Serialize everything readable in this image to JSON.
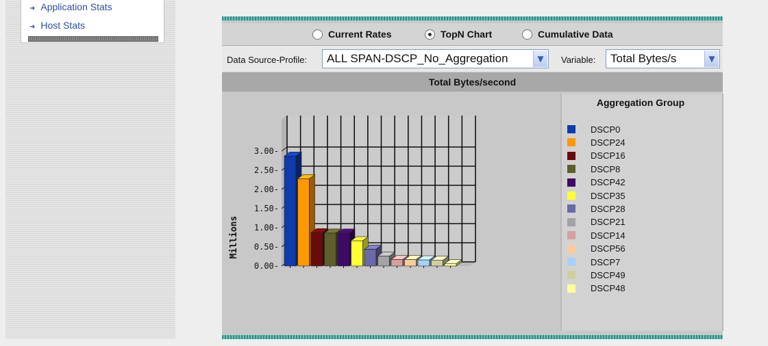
{
  "sidebar": {
    "items": [
      {
        "label": "Application Stats"
      },
      {
        "label": "Host Stats"
      }
    ]
  },
  "controls": {
    "radios": [
      {
        "label": "Current Rates",
        "selected": false
      },
      {
        "label": "TopN Chart",
        "selected": true
      },
      {
        "label": "Cumulative Data",
        "selected": false
      }
    ],
    "data_source_label": "Data Source-Profile:",
    "data_source_value": "ALL SPAN-DSCP_No_Aggregation",
    "variable_label": "Variable:",
    "variable_value": "Total Bytes/s"
  },
  "chart_title": "Total Bytes/second",
  "chart_data": {
    "type": "bar",
    "title": "Total Bytes/second",
    "ylabel": "Millions",
    "ylim": [
      0,
      3.0
    ],
    "yticks": [
      "0.00",
      "0.50",
      "1.00",
      "1.50",
      "2.00",
      "2.50",
      "3.00"
    ],
    "legend_title": "Aggregation Group",
    "legend_position": "right",
    "grid": true,
    "categories": [
      "DSCP0",
      "DSCP24",
      "DSCP16",
      "DSCP8",
      "DSCP42",
      "DSCP35",
      "DSCP28",
      "DSCP21",
      "DSCP14",
      "DSCP56",
      "DSCP7",
      "DSCP49",
      "DSCP48"
    ],
    "values": [
      2.87,
      2.28,
      0.87,
      0.86,
      0.86,
      0.66,
      0.44,
      0.26,
      0.17,
      0.17,
      0.16,
      0.15,
      0.06
    ],
    "colors": [
      "#0f3bab",
      "#ff9900",
      "#6b0a0a",
      "#5f5f2a",
      "#3d0a66",
      "#ffff33",
      "#6a6aa8",
      "#a3a3a3",
      "#d4a0a0",
      "#ffcc99",
      "#a8d0ff",
      "#cfcf9f",
      "#ffff99"
    ]
  }
}
